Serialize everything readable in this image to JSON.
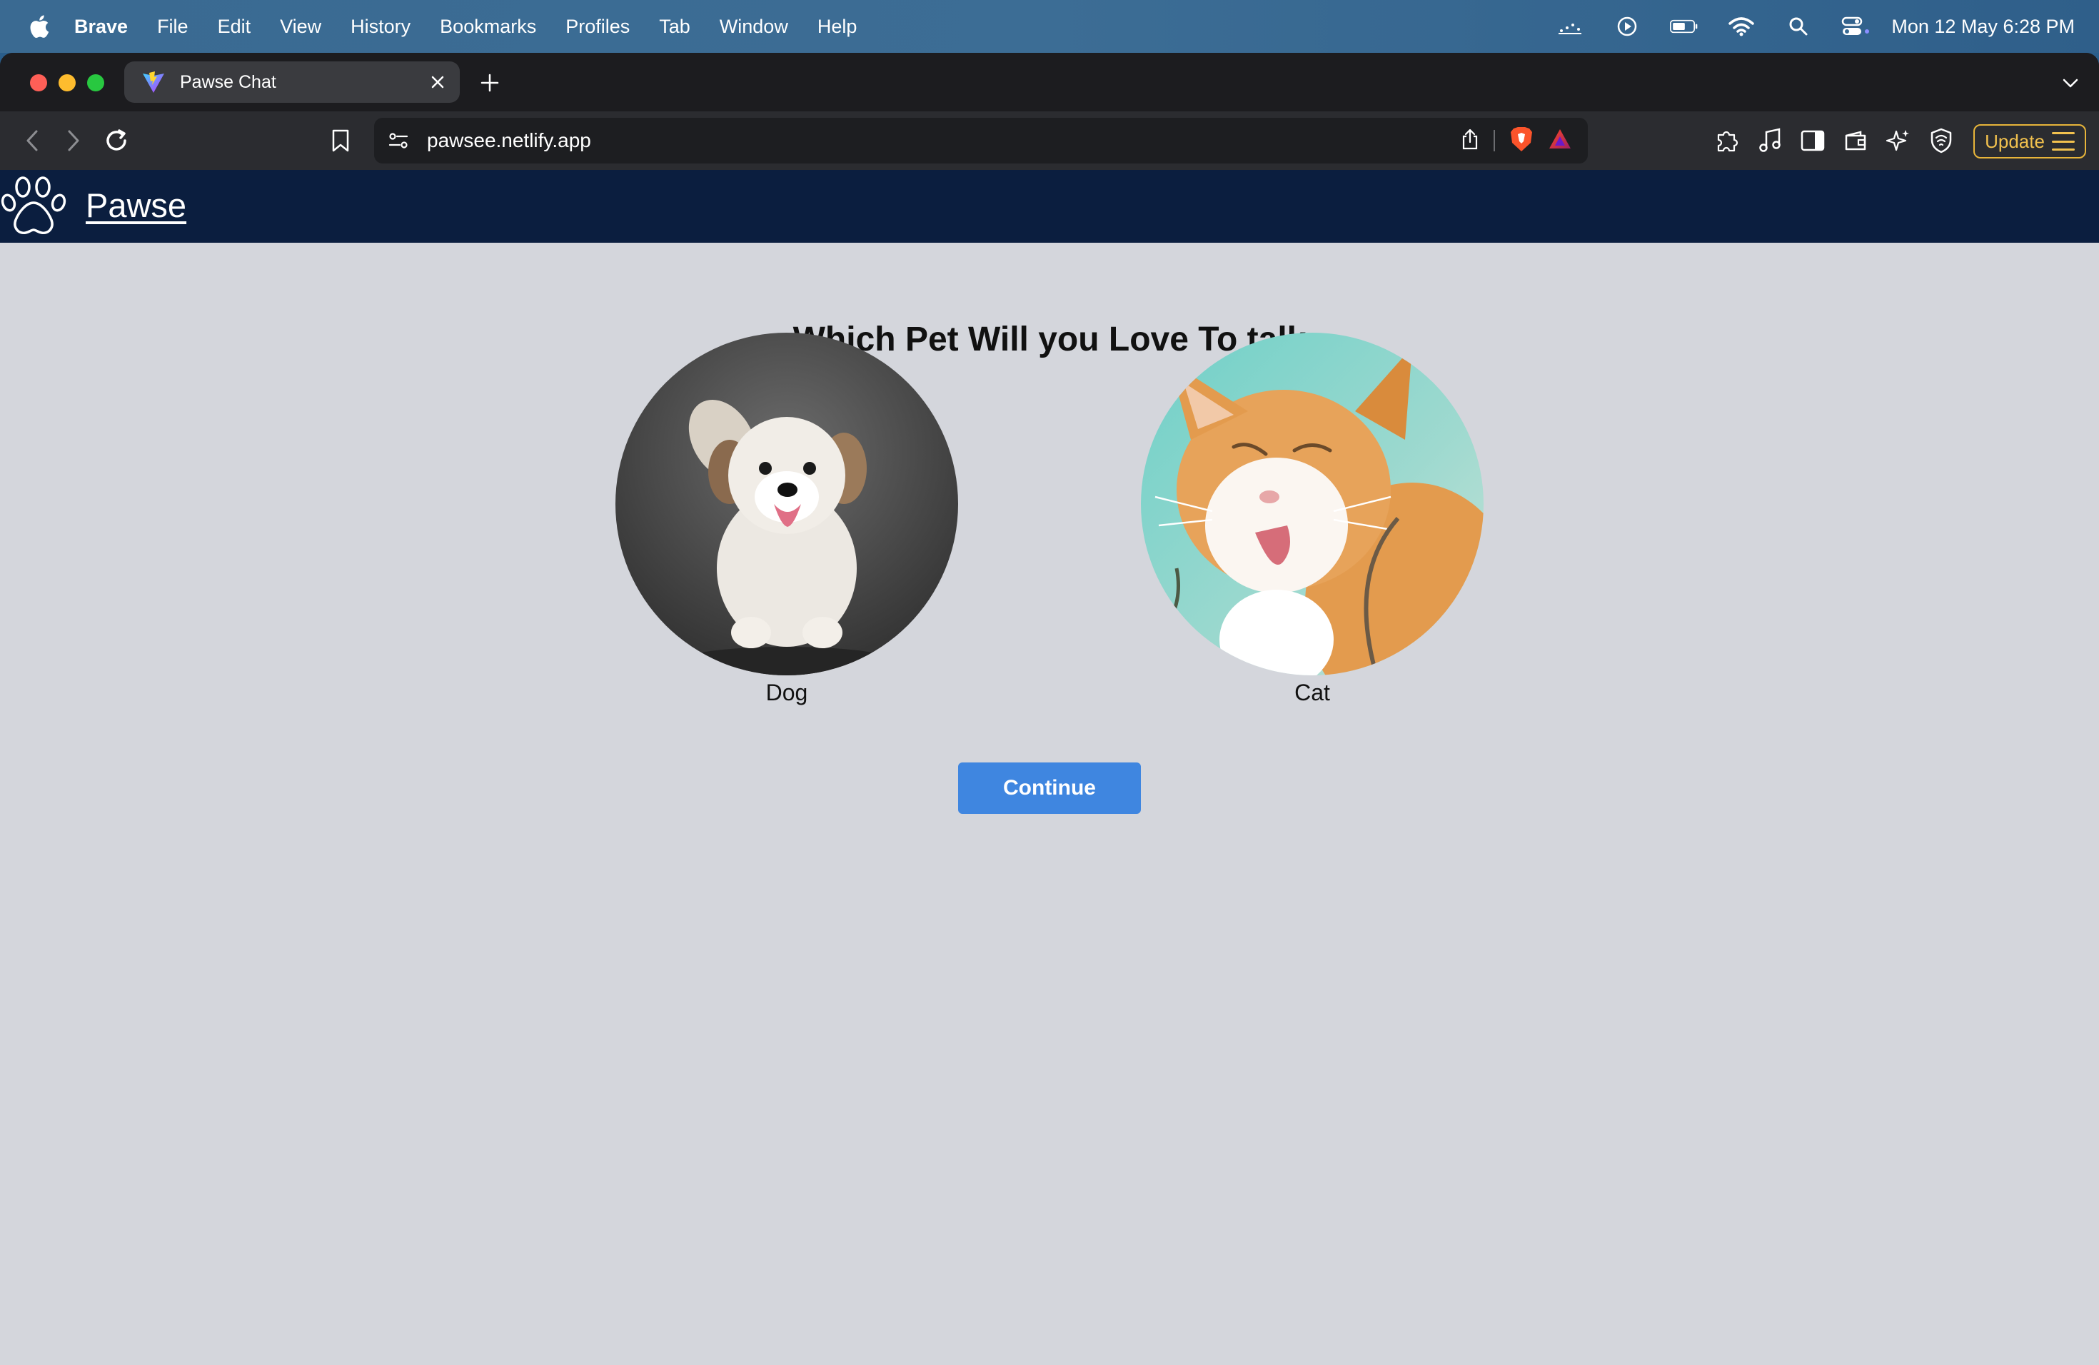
{
  "menubar": {
    "app_name": "Brave",
    "items": [
      "File",
      "Edit",
      "View",
      "History",
      "Bookmarks",
      "Profiles",
      "Tab",
      "Window",
      "Help"
    ],
    "clock": "Mon 12 May  6:28 PM"
  },
  "browser": {
    "tab": {
      "title": "Pawse Chat"
    },
    "url": "pawsee.netlify.app",
    "update_label": "Update"
  },
  "page": {
    "site_name": "Pawse",
    "question": "Which Pet Will you Love To talk",
    "pets": [
      {
        "label": "Dog"
      },
      {
        "label": "Cat"
      }
    ],
    "continue_label": "Continue"
  },
  "colors": {
    "header_bg": "#0b1e3f",
    "page_bg": "#d4d6dc",
    "button_bg": "#3f86e0",
    "update_accent": "#e8b53a"
  }
}
